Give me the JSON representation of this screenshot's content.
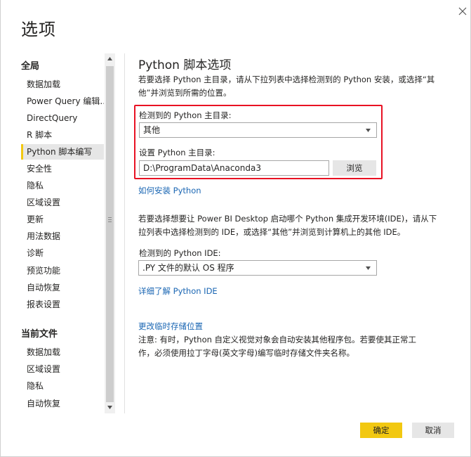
{
  "dialog": {
    "title": "选项",
    "close_icon": "close-icon"
  },
  "nav": {
    "global_heading": "全局",
    "global_items": [
      {
        "label": "数据加载"
      },
      {
        "label": "Power Query 编辑..."
      },
      {
        "label": "DirectQuery"
      },
      {
        "label": "R 脚本"
      },
      {
        "label": "Python 脚本编写",
        "active": true
      },
      {
        "label": "安全性"
      },
      {
        "label": "隐私"
      },
      {
        "label": "区域设置"
      },
      {
        "label": "更新"
      },
      {
        "label": "用法数据"
      },
      {
        "label": "诊断"
      },
      {
        "label": "预览功能"
      },
      {
        "label": "自动恢复"
      },
      {
        "label": "报表设置"
      }
    ],
    "file_heading": "当前文件",
    "file_items": [
      {
        "label": "数据加载"
      },
      {
        "label": "区域设置"
      },
      {
        "label": "隐私"
      },
      {
        "label": "自动恢复"
      }
    ]
  },
  "content": {
    "title": "Python 脚本选项",
    "home_desc_line1": "若要选择 Python 主目录，请从下拉列表中选择检测到的 Python 安装，或选择“其",
    "home_desc_line2": "他”并浏览到所需的位置。",
    "detected_home_label": "检测到的 Python 主目录:",
    "detected_home_value": "其他",
    "set_home_label": "设置 Python 主目录:",
    "set_home_value": "D:\\ProgramData\\Anaconda3",
    "browse_label": "浏览",
    "install_link": "如何安装 Python",
    "ide_desc_line1": "若要选择想要让 Power BI Desktop 启动哪个 Python 集成开发环境(IDE)，请从下",
    "ide_desc_line2": "拉列表中选择检测到的 IDE，或选择“其他”并浏览到计算机上的其他 IDE。",
    "detected_ide_label": "检测到的 Python IDE:",
    "detected_ide_value": ".PY 文件的默认 OS 程序",
    "ide_link": "详细了解 Python IDE",
    "temp_link": "更改临时存储位置",
    "note_line1": "注意: 有时，Python 自定义视觉对象会自动安装其他程序包。若要使其正常工",
    "note_line2": "作，必须使用拉丁字母(英文字母)编写临时存储文件夹名称。"
  },
  "footer": {
    "ok_label": "确定",
    "cancel_label": "取消"
  },
  "colors": {
    "accent": "#f2c811",
    "link": "#1a66b3",
    "highlight": "#e81123"
  }
}
